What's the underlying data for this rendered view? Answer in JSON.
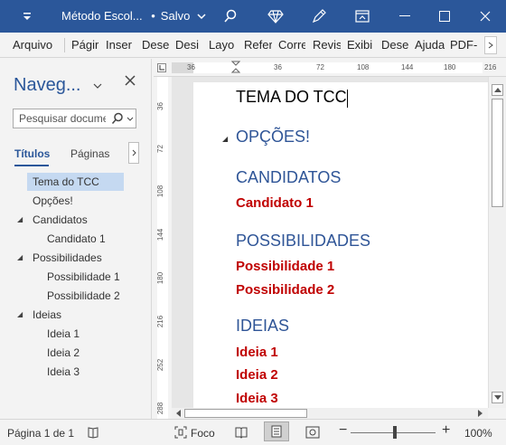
{
  "window": {
    "title": "Método Escol...",
    "save_state": "Salvo",
    "bullet": "•"
  },
  "ribbon": {
    "tabs": [
      "Arquivo",
      "Págir",
      "Inser",
      "Dese",
      "Desi",
      "Layo",
      "Refer",
      "Corre",
      "Revis",
      "Exibi",
      "Dese",
      "Ajuda",
      "PDF-X"
    ]
  },
  "nav": {
    "title": "Naveg...",
    "search_placeholder": "Pesquisar documento",
    "tab_headings": "Títulos",
    "tab_pages": "Páginas",
    "tree": [
      {
        "label": "Tema do TCC",
        "selected": true
      },
      {
        "label": "Opções!"
      },
      {
        "label": "Candidatos",
        "expanded": true
      },
      {
        "label": "Candidato 1"
      },
      {
        "label": "Possibilidades",
        "expanded": true
      },
      {
        "label": "Possibilidade 1"
      },
      {
        "label": "Possibilidade 2"
      },
      {
        "label": "Ideias",
        "expanded": true
      },
      {
        "label": "Ideia 1"
      },
      {
        "label": "Ideia 2"
      },
      {
        "label": "Ideia 3"
      }
    ]
  },
  "ruler": {
    "h_labels": [
      "36",
      "36",
      "72",
      "108",
      "144",
      "180",
      "216"
    ],
    "v_labels": [
      "36",
      "72",
      "108",
      "144",
      "180",
      "216",
      "252",
      "288"
    ]
  },
  "document": {
    "lines": [
      "TEMA DO TCC",
      "OPÇÕES!",
      "CANDIDATOS",
      "Candidato 1",
      "POSSIBILIDADES",
      "Possibilidade 1",
      "Possibilidade 2",
      "IDEIAS",
      "Ideia 1",
      "Ideia 2",
      "Ideia 3"
    ]
  },
  "status": {
    "page": "Página 1 de 1",
    "focus": "Foco",
    "zoom": "100%",
    "minus": "−",
    "plus": "+"
  },
  "colors": {
    "accent": "#2b579a",
    "heading_blue": "#2f5597",
    "heading_red": "#c00000"
  }
}
